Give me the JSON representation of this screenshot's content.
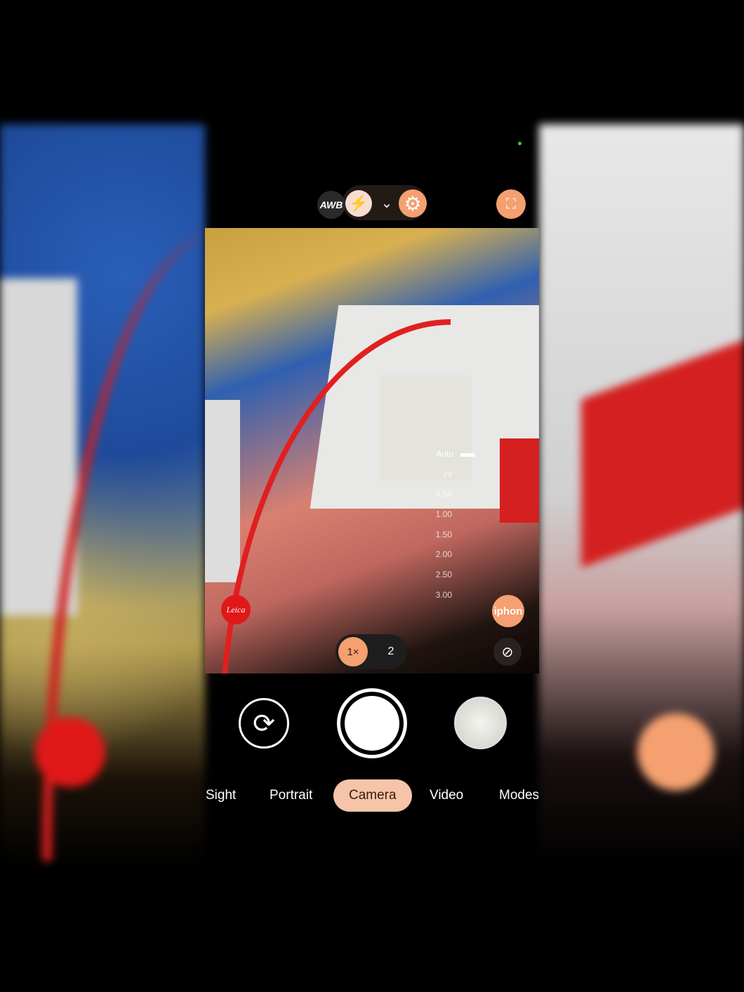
{
  "top_controls": {
    "awb_label": "AWB",
    "flash_icon": "flash-icon",
    "expand_icon": "chevron-down-icon",
    "settings_icon": "gear-icon",
    "lens_icon": "lens-scan-icon"
  },
  "focus_scale": {
    "auto_label": "Auto",
    "values": [
      "inf",
      "0.50",
      "1.00",
      "1.50",
      "2.00",
      "2.50",
      "3.00"
    ]
  },
  "badges": {
    "leica": "Leica",
    "iphone": "iphon"
  },
  "zoom": {
    "options": [
      "1×",
      "2"
    ],
    "selected": "1×"
  },
  "motion_icon": "motion-photo-off-auto-icon",
  "modes": {
    "items": [
      "Sight",
      "Portrait",
      "Camera",
      "Video",
      "Modes"
    ],
    "active": "Camera"
  },
  "colors": {
    "accent": "#f4a070",
    "active_mode": "#f6c4a8",
    "leica_red": "#e01818"
  }
}
